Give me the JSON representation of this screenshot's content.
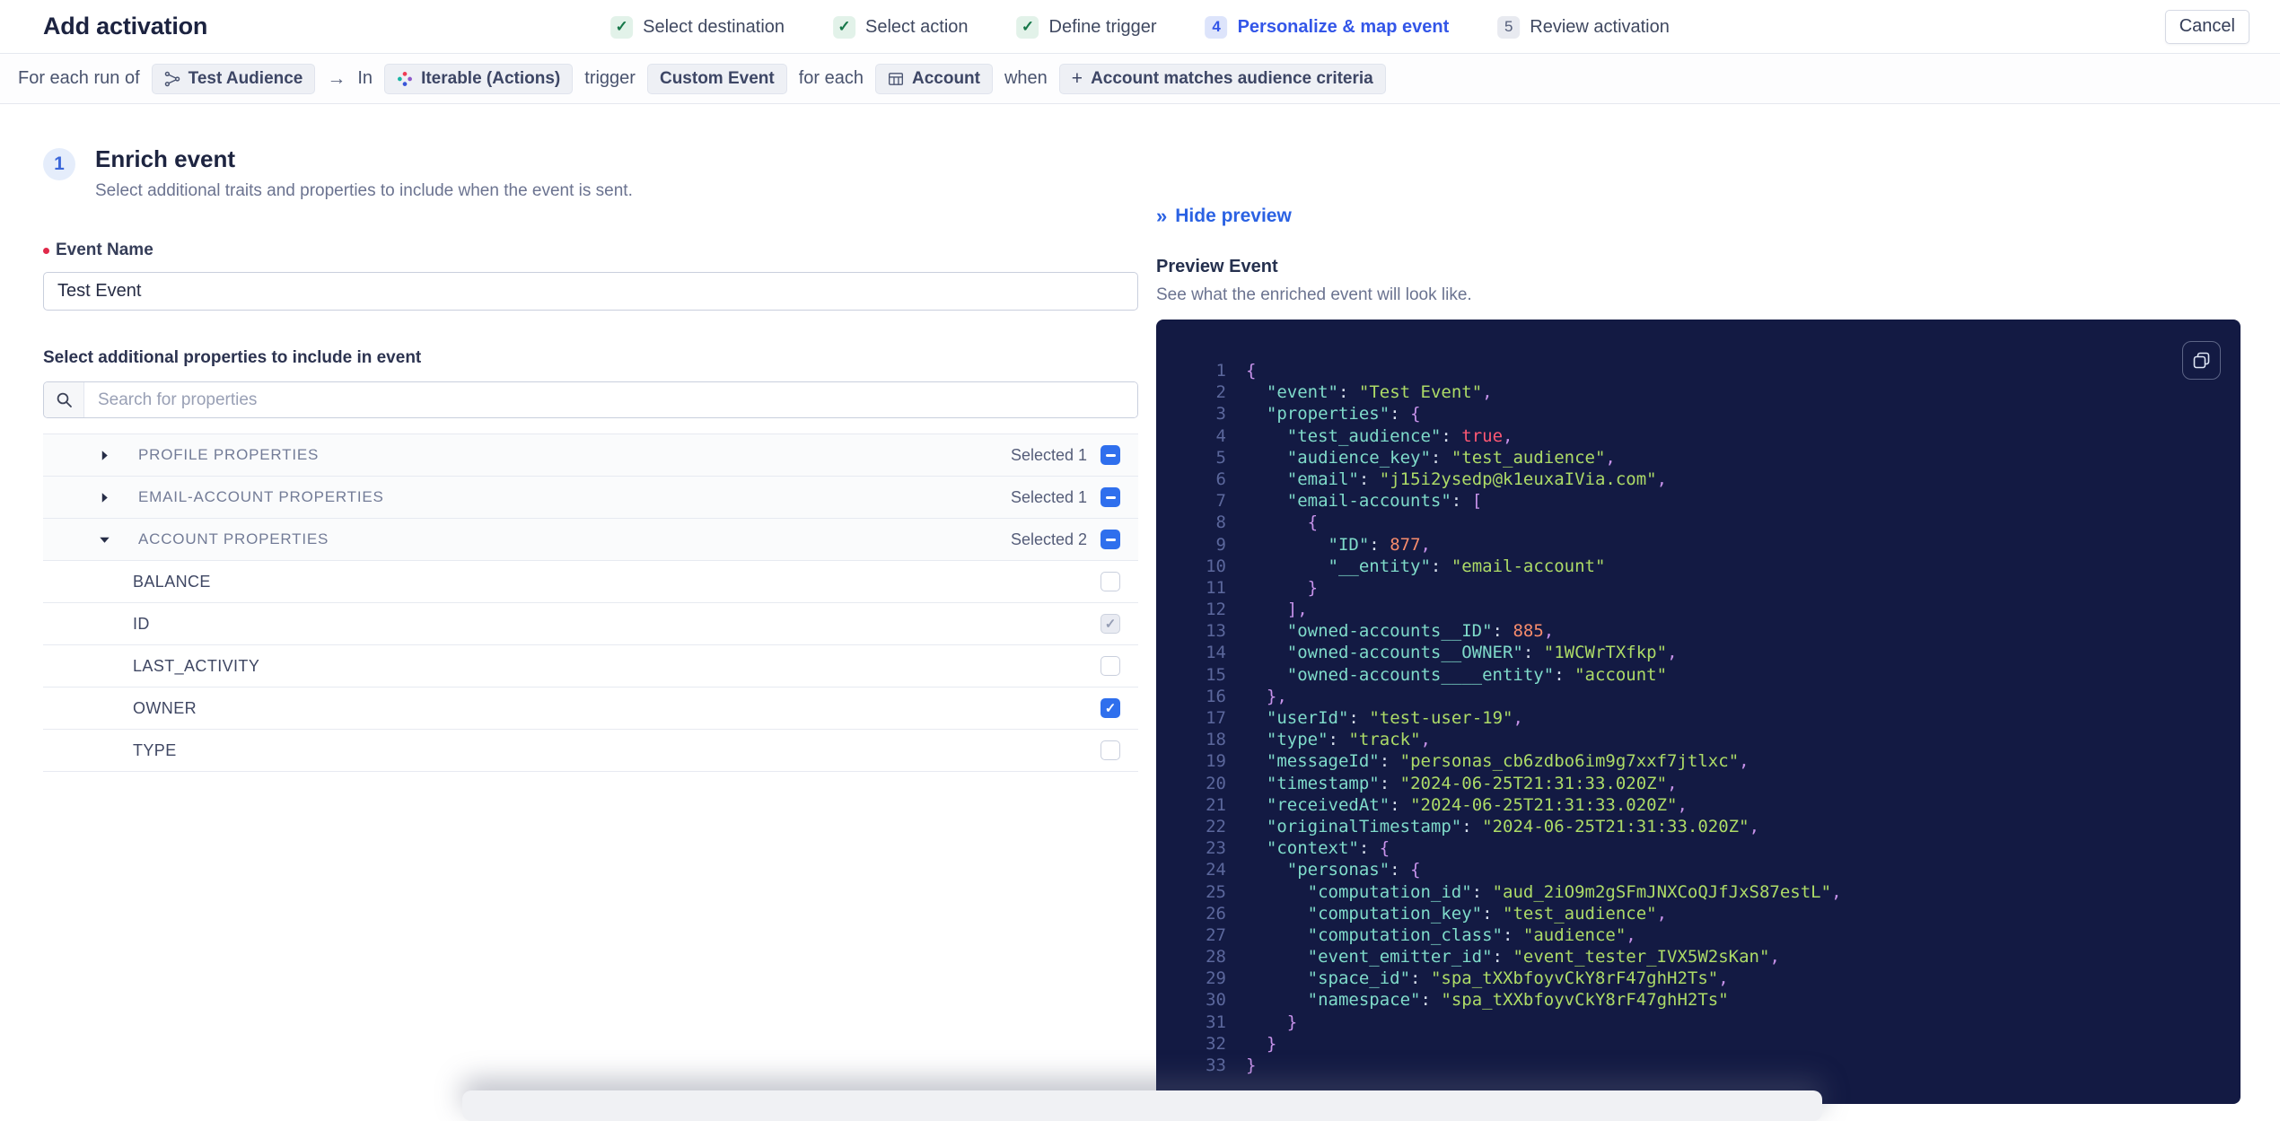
{
  "header": {
    "title": "Add activation",
    "cancel_label": "Cancel",
    "steps": [
      {
        "label": "Select destination",
        "state": "done"
      },
      {
        "label": "Select action",
        "state": "done"
      },
      {
        "label": "Define trigger",
        "state": "done"
      },
      {
        "label": "Personalize & map event",
        "state": "active",
        "number": "4"
      },
      {
        "label": "Review activation",
        "state": "upcoming",
        "number": "5"
      }
    ]
  },
  "criteria_bar": {
    "tokens": [
      {
        "type": "text",
        "text": "For each run of"
      },
      {
        "type": "chip",
        "icon": "audience-icon",
        "label": "Test Audience"
      },
      {
        "type": "arrow",
        "text": "→"
      },
      {
        "type": "text",
        "text": "In"
      },
      {
        "type": "chip",
        "icon": "iterable-icon",
        "label": "Iterable (Actions)"
      },
      {
        "type": "text",
        "text": "trigger"
      },
      {
        "type": "chip",
        "label": "Custom Event"
      },
      {
        "type": "text",
        "text": "for each"
      },
      {
        "type": "chip",
        "icon": "table-icon",
        "label": "Account"
      },
      {
        "type": "text",
        "text": "when"
      },
      {
        "type": "chip",
        "icon": "plus-icon",
        "label": "Account matches audience criteria"
      }
    ]
  },
  "enrich": {
    "step_number": "1",
    "title": "Enrich event",
    "subtitle": "Select additional traits and properties to include when the event is sent.",
    "event_name_label": "Event Name",
    "event_name_value": "Test Event",
    "properties_label": "Select additional properties to include in event",
    "search_placeholder": "Search for properties",
    "sections": [
      {
        "label": "PROFILE PROPERTIES",
        "selected": "Selected 1",
        "expanded": false,
        "checkbox": "indeterminate",
        "rows": []
      },
      {
        "label": "EMAIL-ACCOUNT PROPERTIES",
        "selected": "Selected 1",
        "expanded": false,
        "checkbox": "indeterminate",
        "rows": []
      },
      {
        "label": "ACCOUNT PROPERTIES",
        "selected": "Selected 2",
        "expanded": true,
        "checkbox": "indeterminate",
        "rows": [
          {
            "label": "BALANCE",
            "checkbox": "unchecked"
          },
          {
            "label": "ID",
            "checkbox": "checked-disabled"
          },
          {
            "label": "LAST_ACTIVITY",
            "checkbox": "unchecked"
          },
          {
            "label": "OWNER",
            "checkbox": "checked"
          },
          {
            "label": "TYPE",
            "checkbox": "unchecked"
          }
        ]
      }
    ]
  },
  "preview": {
    "hide_label": "Hide preview",
    "title": "Preview Event",
    "subtitle": "See what the enriched event will look like.",
    "json": "{\n  \"event\": \"Test Event\",\n  \"properties\": {\n    \"test_audience\": true,\n    \"audience_key\": \"test_audience\",\n    \"email\": \"j15i2ysedp@k1euxaIVia.com\",\n    \"email-accounts\": [\n      {\n        \"ID\": 877,\n        \"__entity\": \"email-account\"\n      }\n    ],\n    \"owned-accounts__ID\": 885,\n    \"owned-accounts__OWNER\": \"1WCWrTXfkp\",\n    \"owned-accounts____entity\": \"account\"\n  },\n  \"userId\": \"test-user-19\",\n  \"type\": \"track\",\n  \"messageId\": \"personas_cb6zdbo6im9g7xxf7jtlxc\",\n  \"timestamp\": \"2024-06-25T21:31:33.020Z\",\n  \"receivedAt\": \"2024-06-25T21:31:33.020Z\",\n  \"originalTimestamp\": \"2024-06-25T21:31:33.020Z\",\n  \"context\": {\n    \"personas\": {\n      \"computation_id\": \"aud_2iO9m2gSFmJNXCoQJfJxS87estL\",\n      \"computation_key\": \"test_audience\",\n      \"computation_class\": \"audience\",\n      \"event_emitter_id\": \"event_tester_IVX5W2sKan\",\n      \"space_id\": \"spa_tXXbfoyvCkY8rF47ghH2Ts\",\n      \"namespace\": \"spa_tXXbfoyvCkY8rF47ghH2Ts\"\n    }\n  }\n}"
  },
  "colors": {
    "accent_blue": "#3356e8",
    "link_blue": "#2b62e3",
    "checkbox_blue": "#2f6fed",
    "step_done_green": "#17784a",
    "required_red": "#e0294a",
    "code_background": "#131a43",
    "code_key": "#7fdbca",
    "code_string": "#addb67",
    "code_number": "#f78c6c",
    "code_boolean": "#ff5874",
    "code_punctuation": "#c792ea"
  }
}
